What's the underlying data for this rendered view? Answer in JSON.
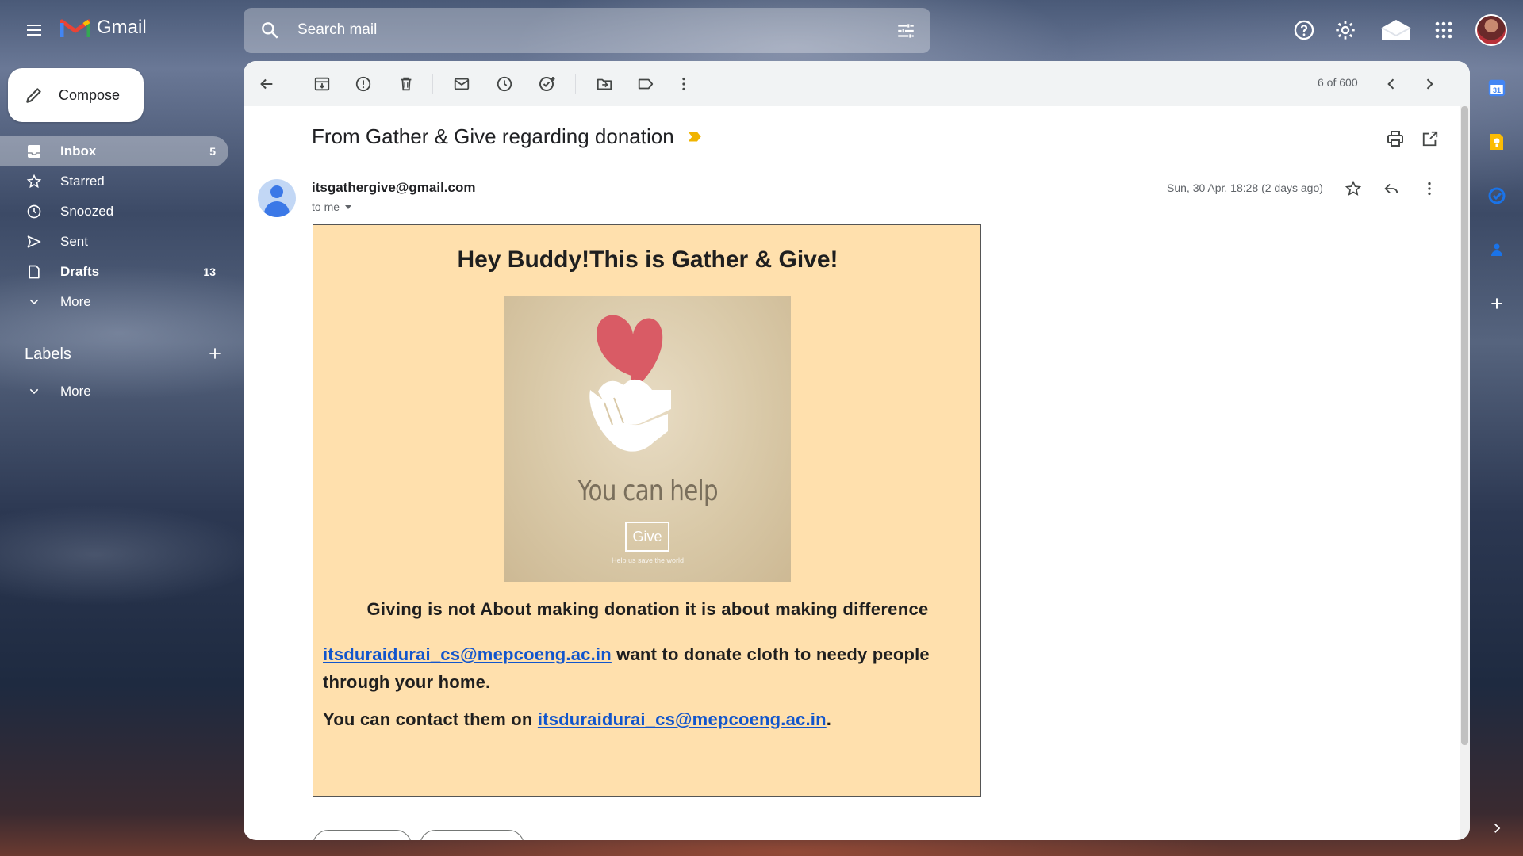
{
  "app": {
    "name": "Gmail"
  },
  "search": {
    "placeholder": "Search mail"
  },
  "compose": {
    "label": "Compose"
  },
  "nav": {
    "items": [
      {
        "label": "Inbox",
        "count": "5",
        "icon": "inbox-icon"
      },
      {
        "label": "Starred",
        "count": "",
        "icon": "star-icon"
      },
      {
        "label": "Snoozed",
        "count": "",
        "icon": "clock-icon"
      },
      {
        "label": "Sent",
        "count": "",
        "icon": "send-icon"
      },
      {
        "label": "Drafts",
        "count": "13",
        "icon": "draft-icon"
      },
      {
        "label": "More",
        "count": "",
        "icon": "chevron-down-icon"
      }
    ]
  },
  "labels": {
    "heading": "Labels",
    "more": "More"
  },
  "toolbar": {
    "pager": "6 of 600"
  },
  "email": {
    "subject": "From Gather & Give regarding donation",
    "sender": "itsgathergive@gmail.com",
    "to": "to me",
    "date": "Sun, 30 Apr, 18:28 (2 days ago)",
    "body": {
      "title": "Hey Buddy!This is Gather & Give!",
      "poster_text": "You can help",
      "poster_button": "Give",
      "poster_sub": "Help us save the world",
      "tagline": "Giving is not About making donation it is about making difference",
      "para1_link": "itsduraidurai_cs@mepcoeng.ac.in",
      "para1_rest": " want to donate cloth to needy people through your home.",
      "para2_pre": "You can contact them on ",
      "para2_link": "itsduraidurai_cs@mepcoeng.ac.in",
      "para2_post": "."
    }
  },
  "colors": {
    "gmail_red": "#ea4335",
    "link": "#1155cc",
    "card_bg": "#ffe0ad",
    "heart": "#d95b65"
  }
}
